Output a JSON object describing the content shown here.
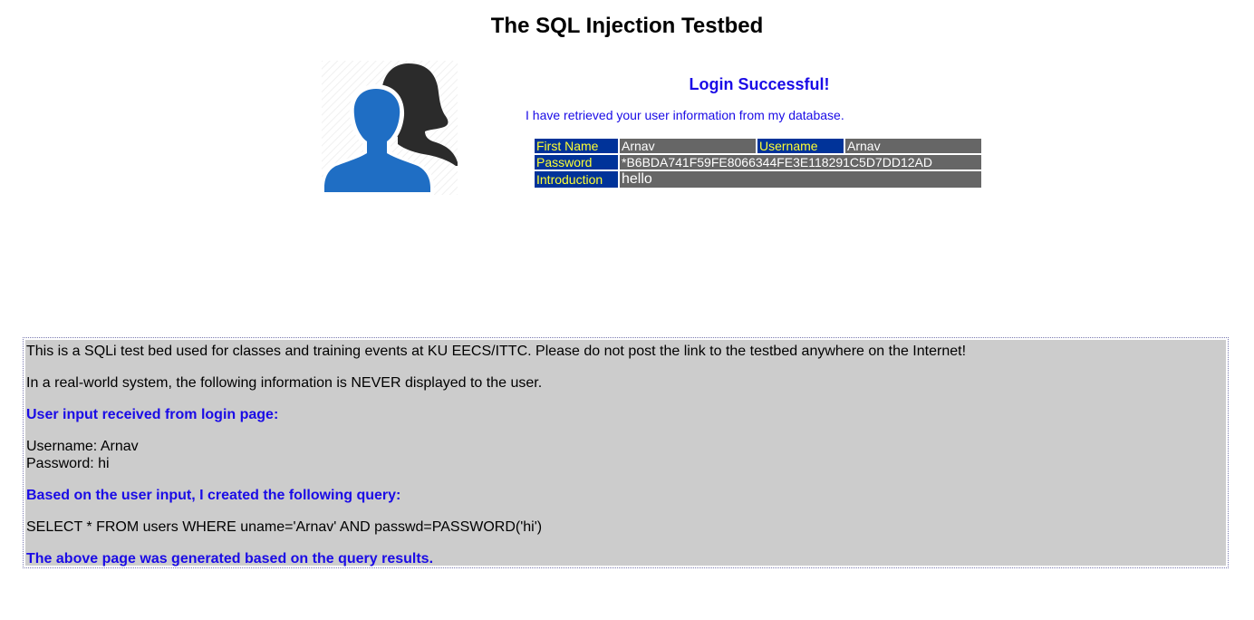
{
  "page": {
    "title": "The SQL Injection Testbed"
  },
  "result": {
    "title": "Login Successful!",
    "message": "I have retrieved your user information from my database."
  },
  "user_table": {
    "first_name_label": "First Name",
    "first_name_value": "Arnav",
    "username_label": "Username",
    "username_value": "Arnav",
    "password_label": "Password",
    "password_value": "*B6BDA741F59FE8066344FE3E118291C5D7DD12AD",
    "introduction_label": "Introduction",
    "introduction_value": "hello"
  },
  "debug": {
    "notice": "This is a SQLi test bed used for classes and training events at KU EECS/ITTC. Please do not post the link to the testbed anywhere on the Internet!",
    "warning": "In a real-world system, the following information is NEVER displayed to the user.",
    "input_heading": "User input received from login page:",
    "username_line": "Username: Arnav",
    "password_line": "Password: hi",
    "query_heading": "Based on the user input, I created the following query:",
    "query": "SELECT * FROM users WHERE uname='Arnav' AND passwd=PASSWORD('hi')",
    "footer": "The above page was generated based on the query results."
  },
  "colors": {
    "accent_blue": "#1a0be6",
    "label_bg": "#003399",
    "label_text": "#ffff33",
    "value_bg": "#666666",
    "debug_bg": "#cccccc"
  },
  "icons": {
    "avatar": "users-icon"
  }
}
